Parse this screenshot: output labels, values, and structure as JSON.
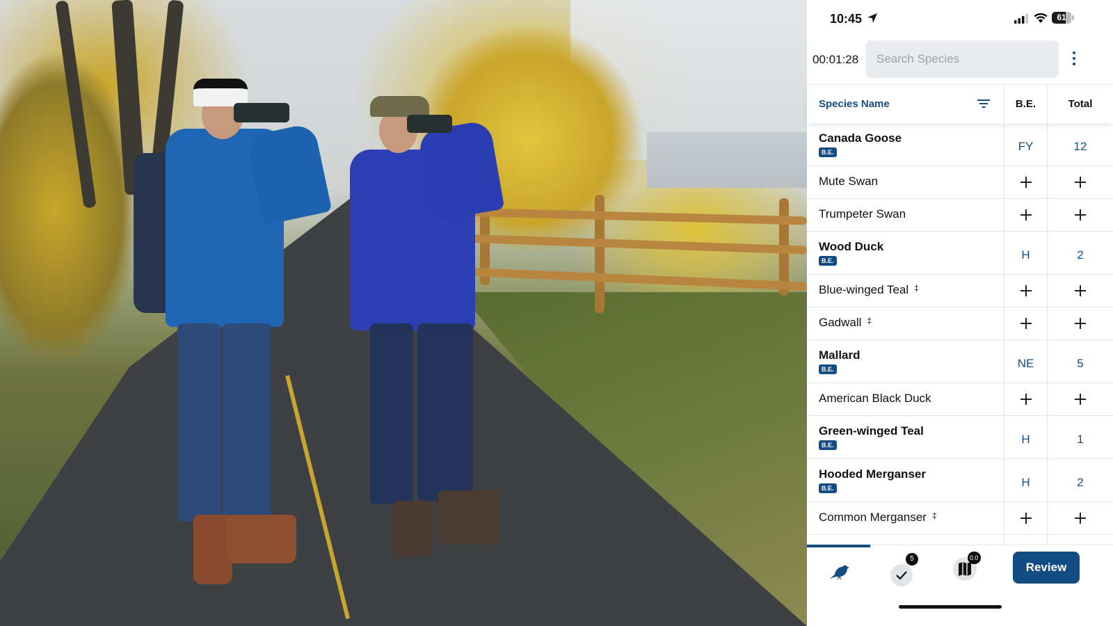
{
  "status_bar": {
    "time": "10:45",
    "battery": "61",
    "icons": [
      "location-arrow-icon",
      "signal-icon",
      "wifi-icon",
      "battery-icon"
    ]
  },
  "toolbar": {
    "timer": "00:01:28",
    "search_placeholder": "Search Species",
    "search_value": "",
    "menu_icon": "kebab-menu-icon"
  },
  "table": {
    "columns": {
      "name": "Species Name",
      "be": "B.E.",
      "total": "Total"
    },
    "badge_label": "B.E.",
    "rows": [
      {
        "name": "Canada Goose",
        "be_badge": true,
        "dagger": false,
        "be_code": "FY",
        "total": "12"
      },
      {
        "name": "Mute Swan",
        "be_badge": false,
        "dagger": false,
        "be_code": "",
        "total": ""
      },
      {
        "name": "Trumpeter Swan",
        "be_badge": false,
        "dagger": false,
        "be_code": "",
        "total": ""
      },
      {
        "name": "Wood Duck",
        "be_badge": true,
        "dagger": false,
        "be_code": "H",
        "total": "2"
      },
      {
        "name": "Blue-winged Teal",
        "be_badge": false,
        "dagger": true,
        "be_code": "",
        "total": ""
      },
      {
        "name": "Gadwall",
        "be_badge": false,
        "dagger": true,
        "be_code": "",
        "total": ""
      },
      {
        "name": "Mallard",
        "be_badge": true,
        "dagger": false,
        "be_code": "NE",
        "total": "5"
      },
      {
        "name": "American Black Duck",
        "be_badge": false,
        "dagger": false,
        "be_code": "",
        "total": ""
      },
      {
        "name": "Green-winged Teal",
        "be_badge": true,
        "dagger": false,
        "be_code": "H",
        "total": "1"
      },
      {
        "name": "Hooded Merganser",
        "be_badge": true,
        "dagger": false,
        "be_code": "H",
        "total": "2"
      },
      {
        "name": "Common Merganser",
        "be_badge": false,
        "dagger": true,
        "be_code": "",
        "total": ""
      }
    ],
    "dagger_symbol": "‡"
  },
  "tabbar": {
    "tabs": [
      {
        "id": "species",
        "icon": "bird-icon",
        "active": true
      },
      {
        "id": "checklist",
        "icon": "checkmark-icon",
        "badge": "5"
      },
      {
        "id": "map",
        "icon": "map-icon",
        "badge": "0.0"
      }
    ],
    "review_label": "Review"
  },
  "colors": {
    "accent": "#134b83",
    "search_bg": "#e9ebee",
    "badge_bg": "#0d0d0d"
  }
}
